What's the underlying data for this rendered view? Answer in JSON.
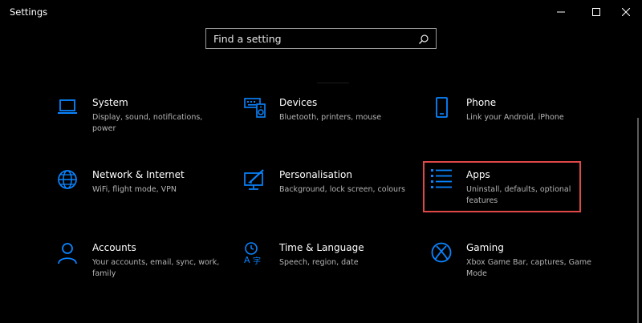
{
  "window": {
    "title": "Settings",
    "controls": {
      "minimize_icon": "minimize-icon",
      "maximize_icon": "maximize-icon",
      "close_icon": "close-icon"
    }
  },
  "search": {
    "placeholder": "Find a setting",
    "icon": "search-icon"
  },
  "colors": {
    "background": "#000000",
    "accent": "#0a84ff",
    "highlight_border": "#e04848",
    "secondary_text": "#b4b4b4"
  },
  "categories": [
    {
      "name": "System",
      "description": "Display, sound, notifications, power",
      "icon": "laptop-icon"
    },
    {
      "name": "Devices",
      "description": "Bluetooth, printers, mouse",
      "icon": "keyboard-speaker-icon"
    },
    {
      "name": "Phone",
      "description": "Link your Android, iPhone",
      "icon": "phone-icon"
    },
    {
      "name": "Network & Internet",
      "description": "WiFi, flight mode, VPN",
      "icon": "globe-icon"
    },
    {
      "name": "Personalisation",
      "description": "Background, lock screen, colours",
      "icon": "paint-monitor-icon"
    },
    {
      "name": "Apps",
      "description": "Uninstall, defaults, optional features",
      "icon": "apps-list-icon",
      "highlighted": true
    },
    {
      "name": "Accounts",
      "description": "Your accounts, email, sync, work, family",
      "icon": "person-icon"
    },
    {
      "name": "Time & Language",
      "description": "Speech, region, date",
      "icon": "time-language-icon"
    },
    {
      "name": "Gaming",
      "description": "Xbox Game Bar, captures, Game Mode",
      "icon": "xbox-icon"
    }
  ]
}
